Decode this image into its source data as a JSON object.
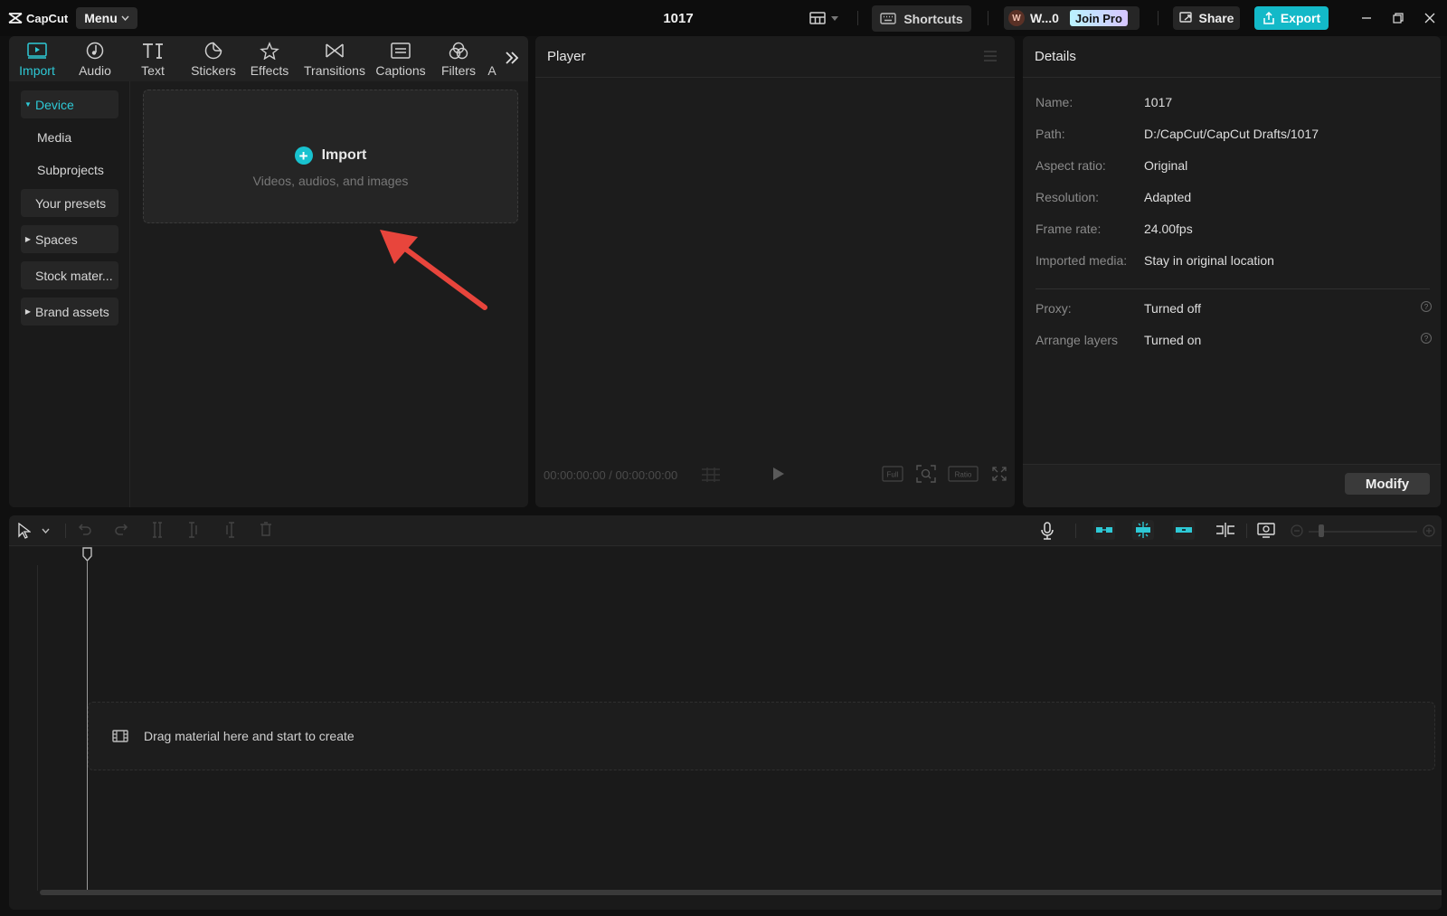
{
  "app": {
    "name": "CapCut",
    "menu_label": "Menu",
    "project_title": "1017"
  },
  "titlebar": {
    "shortcuts_label": "Shortcuts",
    "user_initial": "W",
    "user_name": "W...0",
    "join_pro_label": "Join Pro",
    "share_label": "Share",
    "export_label": "Export"
  },
  "media_tabs": [
    {
      "label": "Import",
      "icon": "import-icon"
    },
    {
      "label": "Audio",
      "icon": "audio-icon"
    },
    {
      "label": "Text",
      "icon": "text-icon"
    },
    {
      "label": "Stickers",
      "icon": "stickers-icon"
    },
    {
      "label": "Effects",
      "icon": "effects-icon"
    },
    {
      "label": "Transitions",
      "icon": "transitions-icon"
    },
    {
      "label": "Captions",
      "icon": "captions-icon"
    },
    {
      "label": "Filters",
      "icon": "filters-icon"
    },
    {
      "label": "A",
      "icon": ""
    }
  ],
  "sidenav": {
    "device": "Device",
    "media": "Media",
    "subprojects": "Subprojects",
    "your_presets": "Your presets",
    "spaces": "Spaces",
    "stock_material": "Stock mater...",
    "brand_assets": "Brand assets"
  },
  "import_zone": {
    "title": "Import",
    "subtitle": "Videos, audios, and images"
  },
  "player": {
    "title": "Player",
    "timecode": "00:00:00:00 / 00:00:00:00",
    "full_label": "Full",
    "ratio_label": "Ratio"
  },
  "details": {
    "title": "Details",
    "rows": [
      {
        "key": "Name:",
        "value": "1017"
      },
      {
        "key": "Path:",
        "value": "D:/CapCut/CapCut Drafts/1017"
      },
      {
        "key": "Aspect ratio:",
        "value": "Original"
      },
      {
        "key": "Resolution:",
        "value": "Adapted"
      },
      {
        "key": "Frame rate:",
        "value": "24.00fps"
      },
      {
        "key": "Imported media:",
        "value": "Stay in original location"
      },
      {
        "key": "Proxy:",
        "value": "Turned off"
      },
      {
        "key": "Arrange layers",
        "value": "Turned on"
      }
    ],
    "modify_label": "Modify"
  },
  "timeline": {
    "drop_hint": "Drag material here and start to create"
  },
  "colors": {
    "accent": "#13b9c8",
    "active_text": "#2ec9d6",
    "arrow": "#e8453c"
  }
}
